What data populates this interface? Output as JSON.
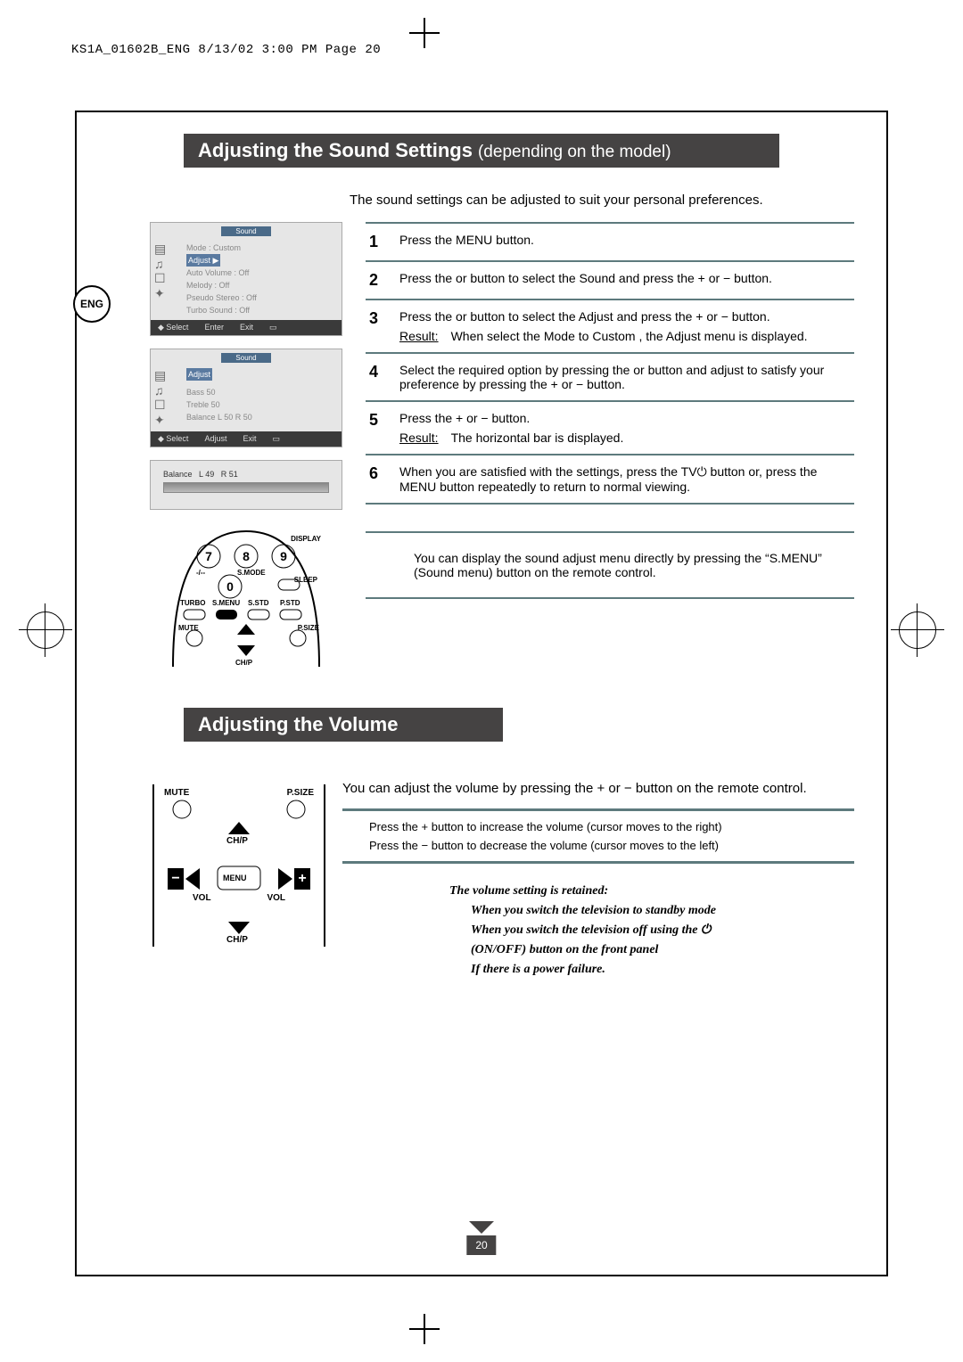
{
  "header": "KS1A_01602B_ENG  8/13/02  3:00 PM  Page 20",
  "lang": "ENG",
  "title1_bold": "Adjusting the Sound Settings",
  "title1_rest": " (depending on the model)",
  "intro": "The sound settings can be adjusted to suit your personal preferences.",
  "osd1": {
    "title": "Sound",
    "items": [
      "Mode        : Custom",
      "Adjust",
      "Auto Volume  : Off",
      "Melody       : Off",
      "Pseudo Stereo : Off",
      "Turbo Sound  : Off"
    ],
    "hl": "Adjust              ▶",
    "foot": [
      "Select",
      "Enter",
      "Exit"
    ]
  },
  "osd2": {
    "title": "Sound",
    "hl": "Adjust",
    "items": [
      "Bass      50",
      "Treble    50",
      "Balance   L 50   R 50"
    ],
    "foot": [
      "Select",
      "Adjust",
      "Exit"
    ]
  },
  "osd3": {
    "label": "Balance",
    "l": "L 49",
    "r": "R 51"
  },
  "remote1": {
    "display": "DISPLAY",
    "sleep": "SLEEP",
    "smode": "S.MODE",
    "turbo": "TURBO",
    "smenu": "S.MENU",
    "sstd": "S.STD",
    "pstd": "P.STD",
    "mute": "MUTE",
    "psize": "P.SIZE",
    "chp": "CH/P"
  },
  "steps": [
    {
      "n": "1",
      "t": "Press the MENU button."
    },
    {
      "n": "2",
      "t": "Press the     or     button to select the  Sound  and press the + or − button."
    },
    {
      "n": "3",
      "t": "Press the     or     button to select the  Adjust  and press the + or − button.",
      "r": "When select the  Mode  to  Custom , the Adjust menu is displayed."
    },
    {
      "n": "4",
      "t": "Select the required option by pressing the     or     button and adjust to satisfy your preference by pressing the + or − button."
    },
    {
      "n": "5",
      "t": "Press the + or − button.",
      "r": "The horizontal bar is displayed."
    },
    {
      "n": "6",
      "t": "When you are satisfied with the settings, press the TV⏻ button or, press the MENU button repeatedly to return to normal viewing."
    }
  ],
  "result_label": "Result:",
  "note": "You can display the sound adjust menu directly by pressing the “S.MENU” (Sound menu) button on the remote control.",
  "title2": "Adjusting the Volume",
  "remote2": {
    "mute": "MUTE",
    "psize": "P.SIZE",
    "chp": "CH/P",
    "menu": "MENU",
    "vol": "VOL"
  },
  "vol_intro": "You can adjust the volume by pressing the + or − button on the remote control.",
  "vbullets": [
    "Press the + button to increase the volume (cursor moves to the right)",
    "Press the − button to decrease the volume (cursor moves to the left)"
  ],
  "italic_head": "The volume setting is retained:",
  "italic_items": [
    "When you switch the television to standby mode",
    "When you switch the television off using the   ⏻",
    "(ON/OFF) button on the front panel",
    "If there is a power failure."
  ],
  "page": "20"
}
